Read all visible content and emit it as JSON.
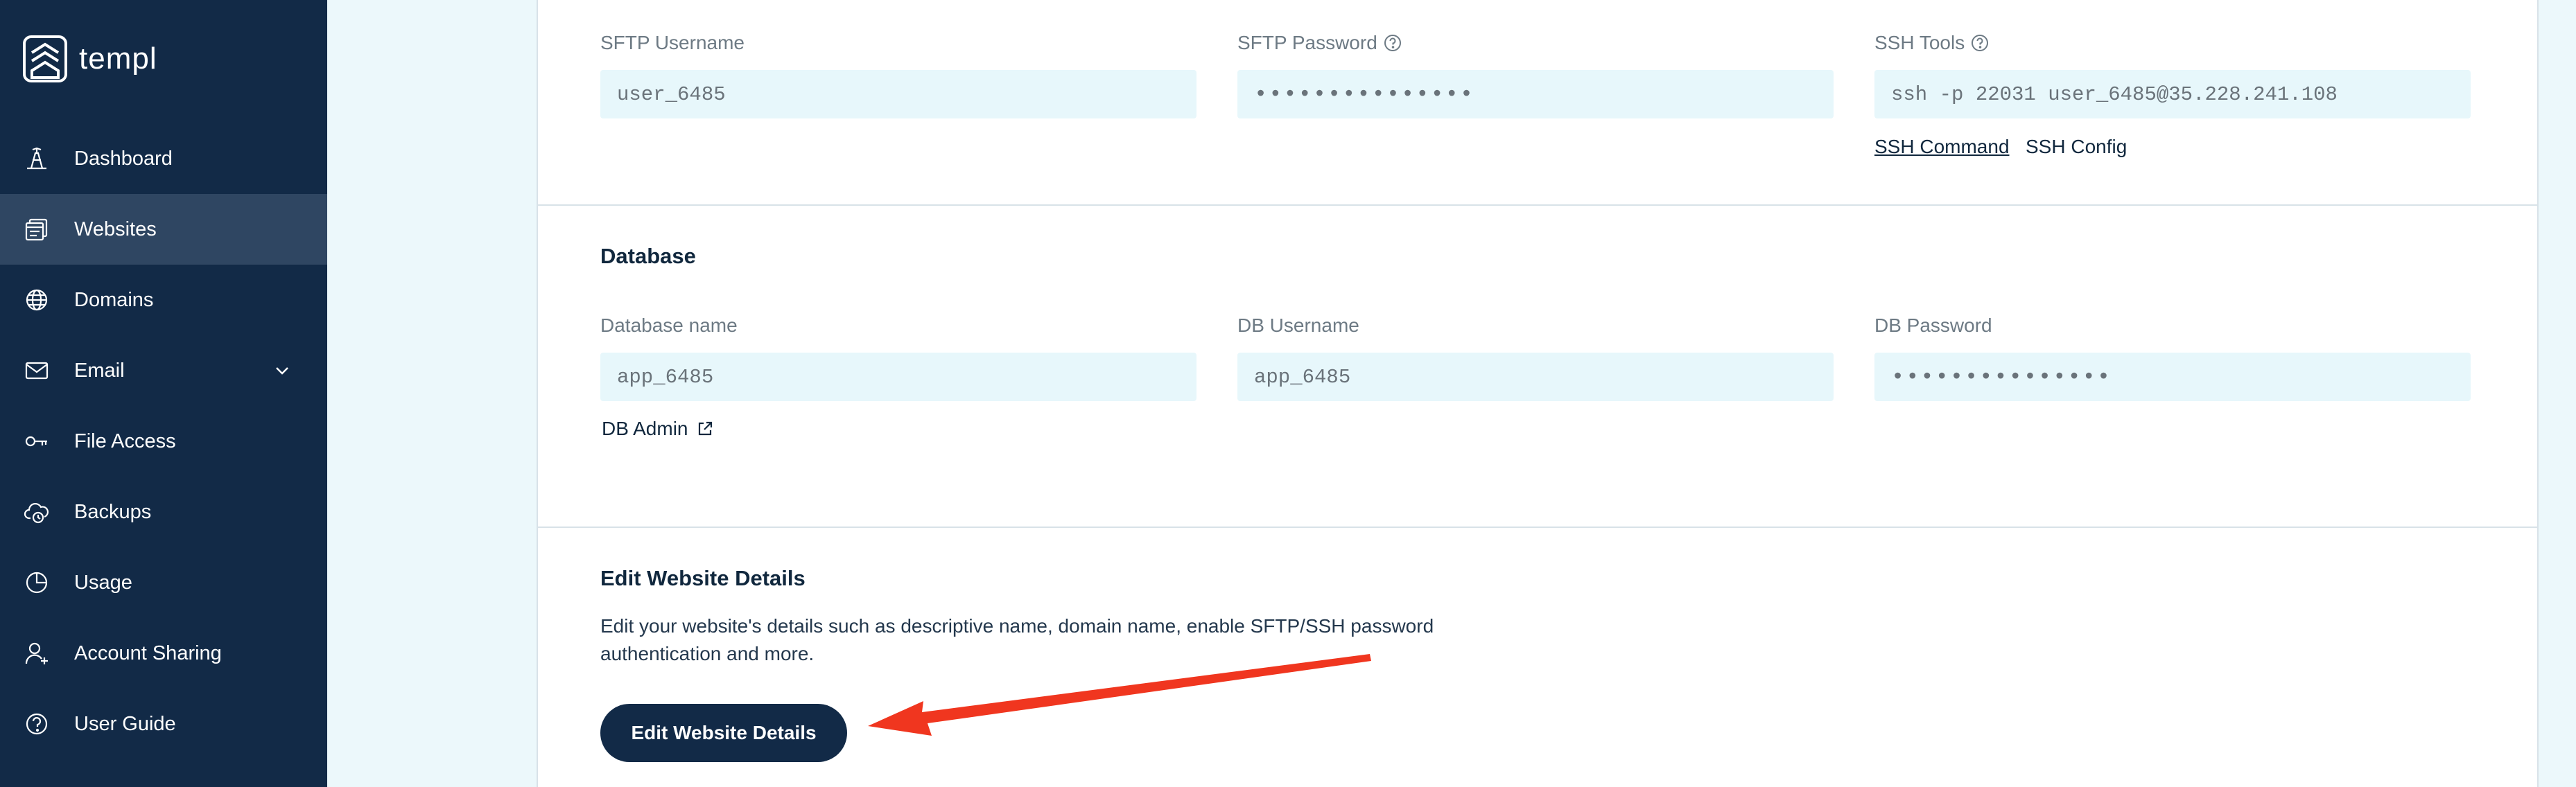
{
  "brand": {
    "name": "templ",
    "logo_icon": "templ-logo-icon"
  },
  "sidebar": {
    "items": [
      {
        "label": "Dashboard",
        "icon": "dashboard-icon",
        "active": false
      },
      {
        "label": "Websites",
        "icon": "websites-icon",
        "active": true
      },
      {
        "label": "Domains",
        "icon": "globe-icon",
        "active": false
      },
      {
        "label": "Email",
        "icon": "envelope-icon",
        "active": false,
        "has_submenu": true
      },
      {
        "label": "File Access",
        "icon": "key-icon",
        "active": false
      },
      {
        "label": "Backups",
        "icon": "cloud-backup-icon",
        "active": false
      },
      {
        "label": "Usage",
        "icon": "pie-chart-icon",
        "active": false
      },
      {
        "label": "Account Sharing",
        "icon": "user-plus-icon",
        "active": false
      },
      {
        "label": "User Guide",
        "icon": "help-circle-icon",
        "active": false
      }
    ]
  },
  "sftp": {
    "username_label": "SFTP Username",
    "username_value": "user_6485",
    "password_label": "SFTP Password",
    "password_value": "•••••••••••••••",
    "ssh_label": "SSH Tools",
    "ssh_value": "ssh -p 22031 user_6485@35.228.241.108",
    "ssh_command_link": "SSH Command",
    "ssh_config_link": "SSH Config"
  },
  "database": {
    "title": "Database",
    "name_label": "Database name",
    "name_value": "app_6485",
    "username_label": "DB Username",
    "username_value": "app_6485",
    "password_label": "DB Password",
    "password_value": "•••••••••••••••",
    "admin_link": "DB Admin"
  },
  "edit_details": {
    "title": "Edit Website Details",
    "description": "Edit your website's details such as descriptive name, domain name, enable SFTP/SSH password authentication and more.",
    "button_label": "Edit Website Details"
  },
  "colors": {
    "sidebar_bg": "#122a47",
    "sidebar_active": "#2f4662",
    "field_bg": "#e7f7fb",
    "arrow": "#f0361f"
  }
}
